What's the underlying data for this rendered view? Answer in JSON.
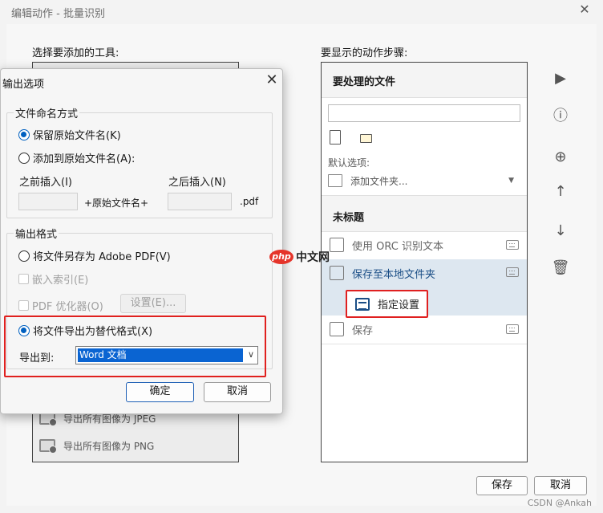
{
  "main": {
    "title": "编辑动作 - 批量识别",
    "close_glyph": "✕",
    "tools_label": "选择要添加的工具:",
    "steps_label": "要显示的动作步骤:",
    "tools_visible": [
      {
        "label": "导出所有图像为 JPEG",
        "icon": "image-export-icon"
      },
      {
        "label": "导出所有图像为 PNG",
        "icon": "image-export-icon"
      }
    ],
    "steps": {
      "files_header": "要处理的文件",
      "default_options": "默认选项:",
      "add_files": "添加文件夹...",
      "untitled_header": "未标题",
      "rows": [
        {
          "label": "使用 ORC 识别文本",
          "icon": "text-recognize-icon"
        },
        {
          "label": "保存至本地文件夹",
          "icon": "save-folder-icon",
          "selected": true
        },
        {
          "label": "保存",
          "icon": "save-icon"
        }
      ],
      "options_button": "指定设置"
    },
    "save_button": "保存",
    "cancel_button": "取消"
  },
  "dialog": {
    "title": "输出选项",
    "close_glyph": "✕",
    "naming": {
      "legend": "文件命名方式",
      "keep_original": "保留原始文件名(K)",
      "add_to_original": "添加到原始文件名(A):",
      "insert_before": "之前插入(I)",
      "insert_after": "之后插入(N)",
      "original_name": "+原始文件名+",
      "ext": ".pdf"
    },
    "format": {
      "legend": "输出格式",
      "save_as_pdf": "将文件另存为 Adobe PDF(V)",
      "embed_index": "嵌入索引(E)",
      "pdf_optimizer": "PDF 优化器(O)",
      "settings_button": "设置(E)...",
      "export_alt": "将文件导出为替代格式(X)",
      "export_to": "导出到:",
      "export_value": "Word 文档"
    },
    "ok_button": "确定",
    "cancel_button": "取消"
  },
  "watermark": "CSDN @Ankah",
  "logo_text": {
    "php": "php",
    "cn": "中文网"
  },
  "colors": {
    "accent": "#0060c0",
    "highlight": "#e0201e",
    "selection": "#0a64d2"
  }
}
